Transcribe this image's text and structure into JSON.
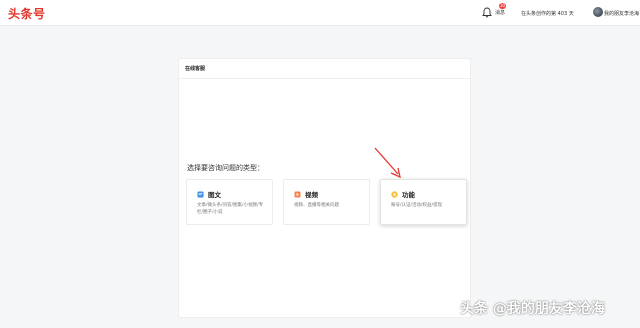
{
  "header": {
    "logo": "头条号",
    "messages_label": "消息",
    "messages_badge": "30",
    "days_text": "在头条创作的第 403 天",
    "username": "我的朋友李沧海"
  },
  "panel": {
    "title": "在线客服",
    "prompt": "选择要咨询问题的类型：",
    "cards": [
      {
        "title": "图文",
        "desc": "文章/微头条/问答/图集/小视频/专栏/圈子/小说",
        "icon": "document-icon",
        "color": "#3a8ee6"
      },
      {
        "title": "视频",
        "desc": "视频、直播等相关问题",
        "icon": "video-icon",
        "color": "#f5834a"
      },
      {
        "title": "功能",
        "desc": "账号/认证/活动/权益/提现",
        "icon": "function-icon",
        "color": "#f7c23a"
      }
    ]
  },
  "watermark": "头条 @我的朋友李沧海",
  "colors": {
    "brand": "#e0362c",
    "arrow": "#e8382f"
  }
}
